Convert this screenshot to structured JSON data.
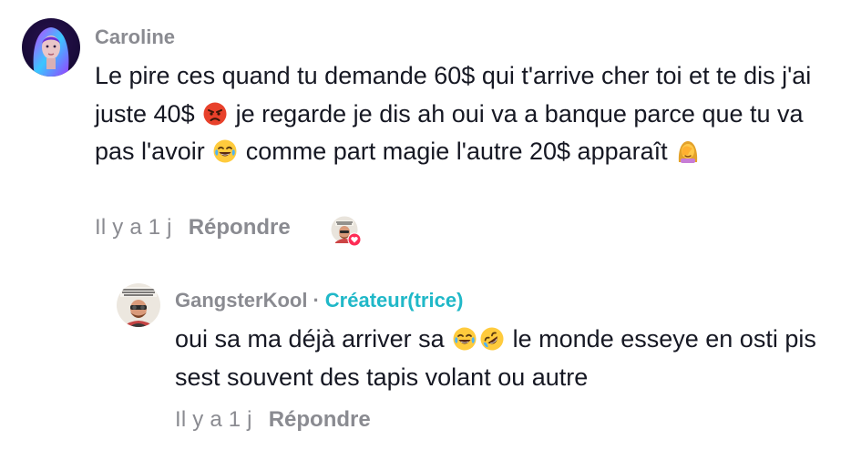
{
  "comment": {
    "author": "Caroline",
    "lines": {
      "p1": "Le pire ces quand tu demande 60$ qui t'arrive cher toi et te dis j'ai juste 40$ ",
      "p2": " je regarde je dis ah oui va a banque parce que tu va pas l'avoir ",
      "p3": " comme part magie l'autre 20$ apparaît "
    },
    "emojis": [
      "angry-face-icon",
      "tears-of-joy-icon",
      "facepalm-woman-icon"
    ],
    "time": "Il y a 1 j",
    "reply_label": "Répondre",
    "liked_by_creator_icon": "creator-heart-avatar-icon"
  },
  "reply": {
    "author": "GangsterKool",
    "separator": "·",
    "badge": "Créateur(trice)",
    "lines": {
      "p1": "oui sa ma déjà arriver sa ",
      "p2": " le monde esseye en osti pis sest souvent des tapis volant ou autre"
    },
    "emojis": [
      "tears-of-joy-icon",
      "rofl-icon"
    ],
    "time": "Il y a 1 j",
    "reply_label": "Répondre"
  },
  "colors": {
    "text": "#161823",
    "meta": "#8a8b91",
    "creator_badge": "#20b8c8",
    "heart": "#fe2c55"
  }
}
